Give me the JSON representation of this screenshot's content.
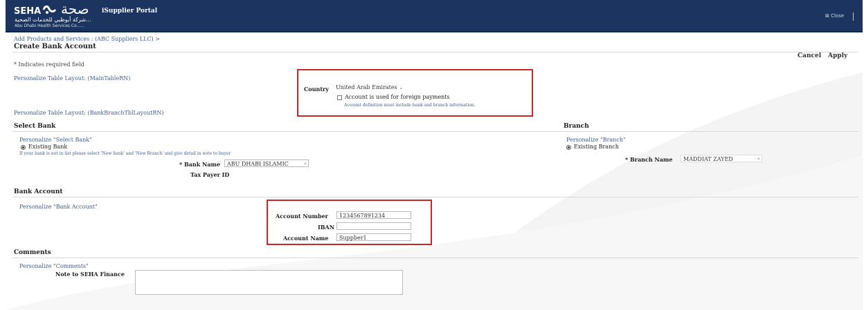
{
  "header": {
    "brand": "SEHA",
    "brand_arabic": "صحة",
    "portal_title": "iSupplier Portal",
    "arabic_sub": "شركة أبوظبي للخدمات الصحية...",
    "english_sub": "Abu Dhabi Health Services Co......",
    "close_label": "Close"
  },
  "breadcrumb": "Add Products and Services : (ABC Suppliers LLC) >",
  "page_title": "Create Bank Account",
  "actions": {
    "cancel": "Cancel",
    "apply": "Apply"
  },
  "required_note": "* Indicates required field",
  "personalize_main": "Personalize Table Layout: (MainTableRN)",
  "personalize_branch_tbl": "Personalize Table Layout: (BankBranchTblLayoutRN)",
  "country": {
    "label": "Country",
    "value": "United Arab Emirates",
    "foreign_label": "Account is used for foreign payments",
    "foreign_checked": false,
    "hint": "Account definition must include bank and branch information."
  },
  "select_bank": {
    "heading": "Select Bank",
    "personalize": "Personalize \"Select Bank\"",
    "existing_bank": "Existing Bank",
    "note": "If your bank is not in list please select 'New bank' and 'New Branch' and give detail in note to buyer",
    "bank_name_label": "* Bank Name",
    "bank_name_value": "ABU DHABI ISLAMIC",
    "tax_payer_label": "Tax Payer ID"
  },
  "branch": {
    "heading": "Branch",
    "personalize": "Personalize \"Branch\"",
    "existing_branch": "Existing Branch",
    "branch_name_label": "* Branch Name",
    "branch_name_value": "MADDIAT ZAYED"
  },
  "bank_account": {
    "heading": "Bank Account",
    "personalize": "Personalize \"Bank Account\"",
    "account_number_label": "Account Number",
    "account_number_value": "1234567891234",
    "iban_label": "IBAN",
    "iban_value": "",
    "account_name_label": "Account Name",
    "account_name_value": "Suppber1"
  },
  "comments": {
    "heading": "Comments",
    "personalize": "Personalize \"Comments\"",
    "note_label": "Note to SEHA Finance",
    "note_value": ""
  },
  "colors": {
    "header_bg": "#1b3560",
    "highlight": "#c8262a",
    "link": "#3d5d8a"
  }
}
